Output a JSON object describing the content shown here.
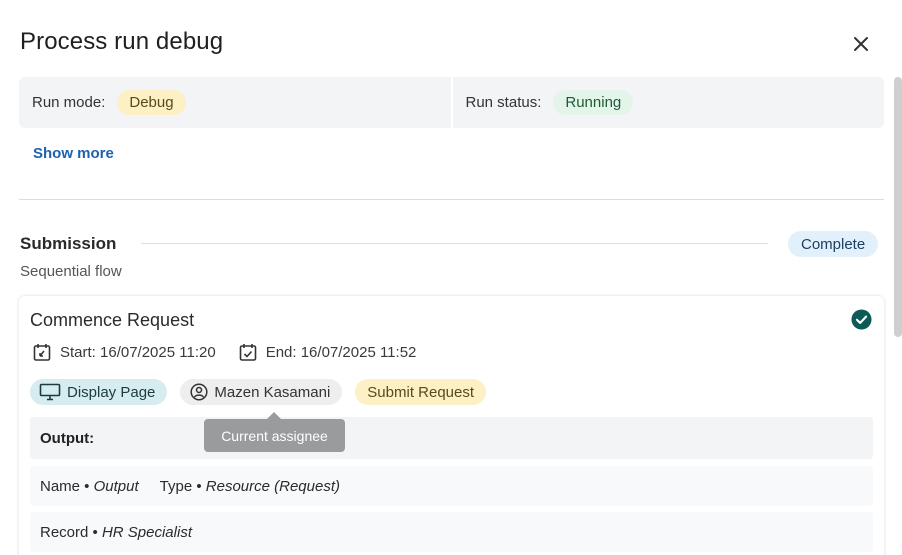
{
  "header": {
    "title": "Process run debug",
    "close_icon": "close-icon"
  },
  "run_info": {
    "mode_label": "Run mode:",
    "mode_value": "Debug",
    "status_label": "Run status:",
    "status_value": "Running",
    "show_more_label": "Show more"
  },
  "section": {
    "title": "Submission",
    "subtitle": "Sequential flow",
    "status": "Complete"
  },
  "step": {
    "title": "Commence Request",
    "status_icon": "check-circle-icon",
    "start": "Start: 16/07/2025 11:20",
    "end": "End: 16/07/2025 11:52",
    "tags": {
      "page": "Display Page",
      "assignee": "Mazen Kasamani",
      "action": "Submit Request"
    },
    "tooltip": "Current assignee",
    "output": {
      "header": "Output:",
      "name_key": "Name",
      "name_value": "Output",
      "type_key": "Type",
      "type_value": "Resource (Request)",
      "record_key": "Record",
      "record_value": "HR Specialist"
    }
  },
  "colors": {
    "accent": "#1c62ad",
    "success": "#0d5b57",
    "debug_pill": "#fdf0c4",
    "running_pill": "#e3f5e8",
    "complete_pill": "#e2f0fb"
  }
}
